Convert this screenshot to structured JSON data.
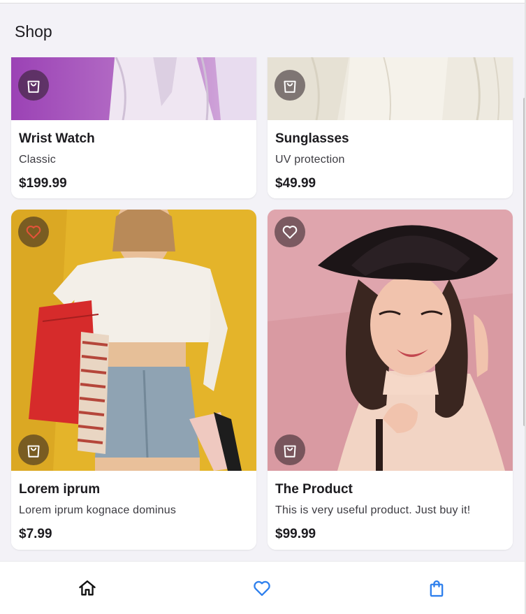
{
  "app": {
    "title": "Shop"
  },
  "colors": {
    "accent": "#2f80ed",
    "heart_active": "#e5533a",
    "icon_white": "#ffffff"
  },
  "products": [
    {
      "title": "Wrist Watch",
      "subtitle": "Classic",
      "price": "$199.99",
      "image": "woman in lilac knit sweater",
      "favorite": false
    },
    {
      "title": "Sunglasses",
      "subtitle": "UV protection",
      "price": "$49.99",
      "image": "cream knit sweater",
      "favorite": false
    },
    {
      "title": "Lorem iprum",
      "subtitle": "Lorem iprum kognace dominus",
      "price": "$7.99",
      "image": "woman with shopping bags on yellow",
      "favorite": true
    },
    {
      "title": "The Product",
      "subtitle": "This is very useful product. Just buy it!",
      "price": "$99.99",
      "image": "woman in black hat on pink",
      "favorite": false
    }
  ],
  "bottom_nav": {
    "items": [
      {
        "icon": "home-icon",
        "active": false
      },
      {
        "icon": "heart-outline-icon",
        "active": false
      },
      {
        "icon": "shopping-bag-icon",
        "active": false
      }
    ]
  }
}
